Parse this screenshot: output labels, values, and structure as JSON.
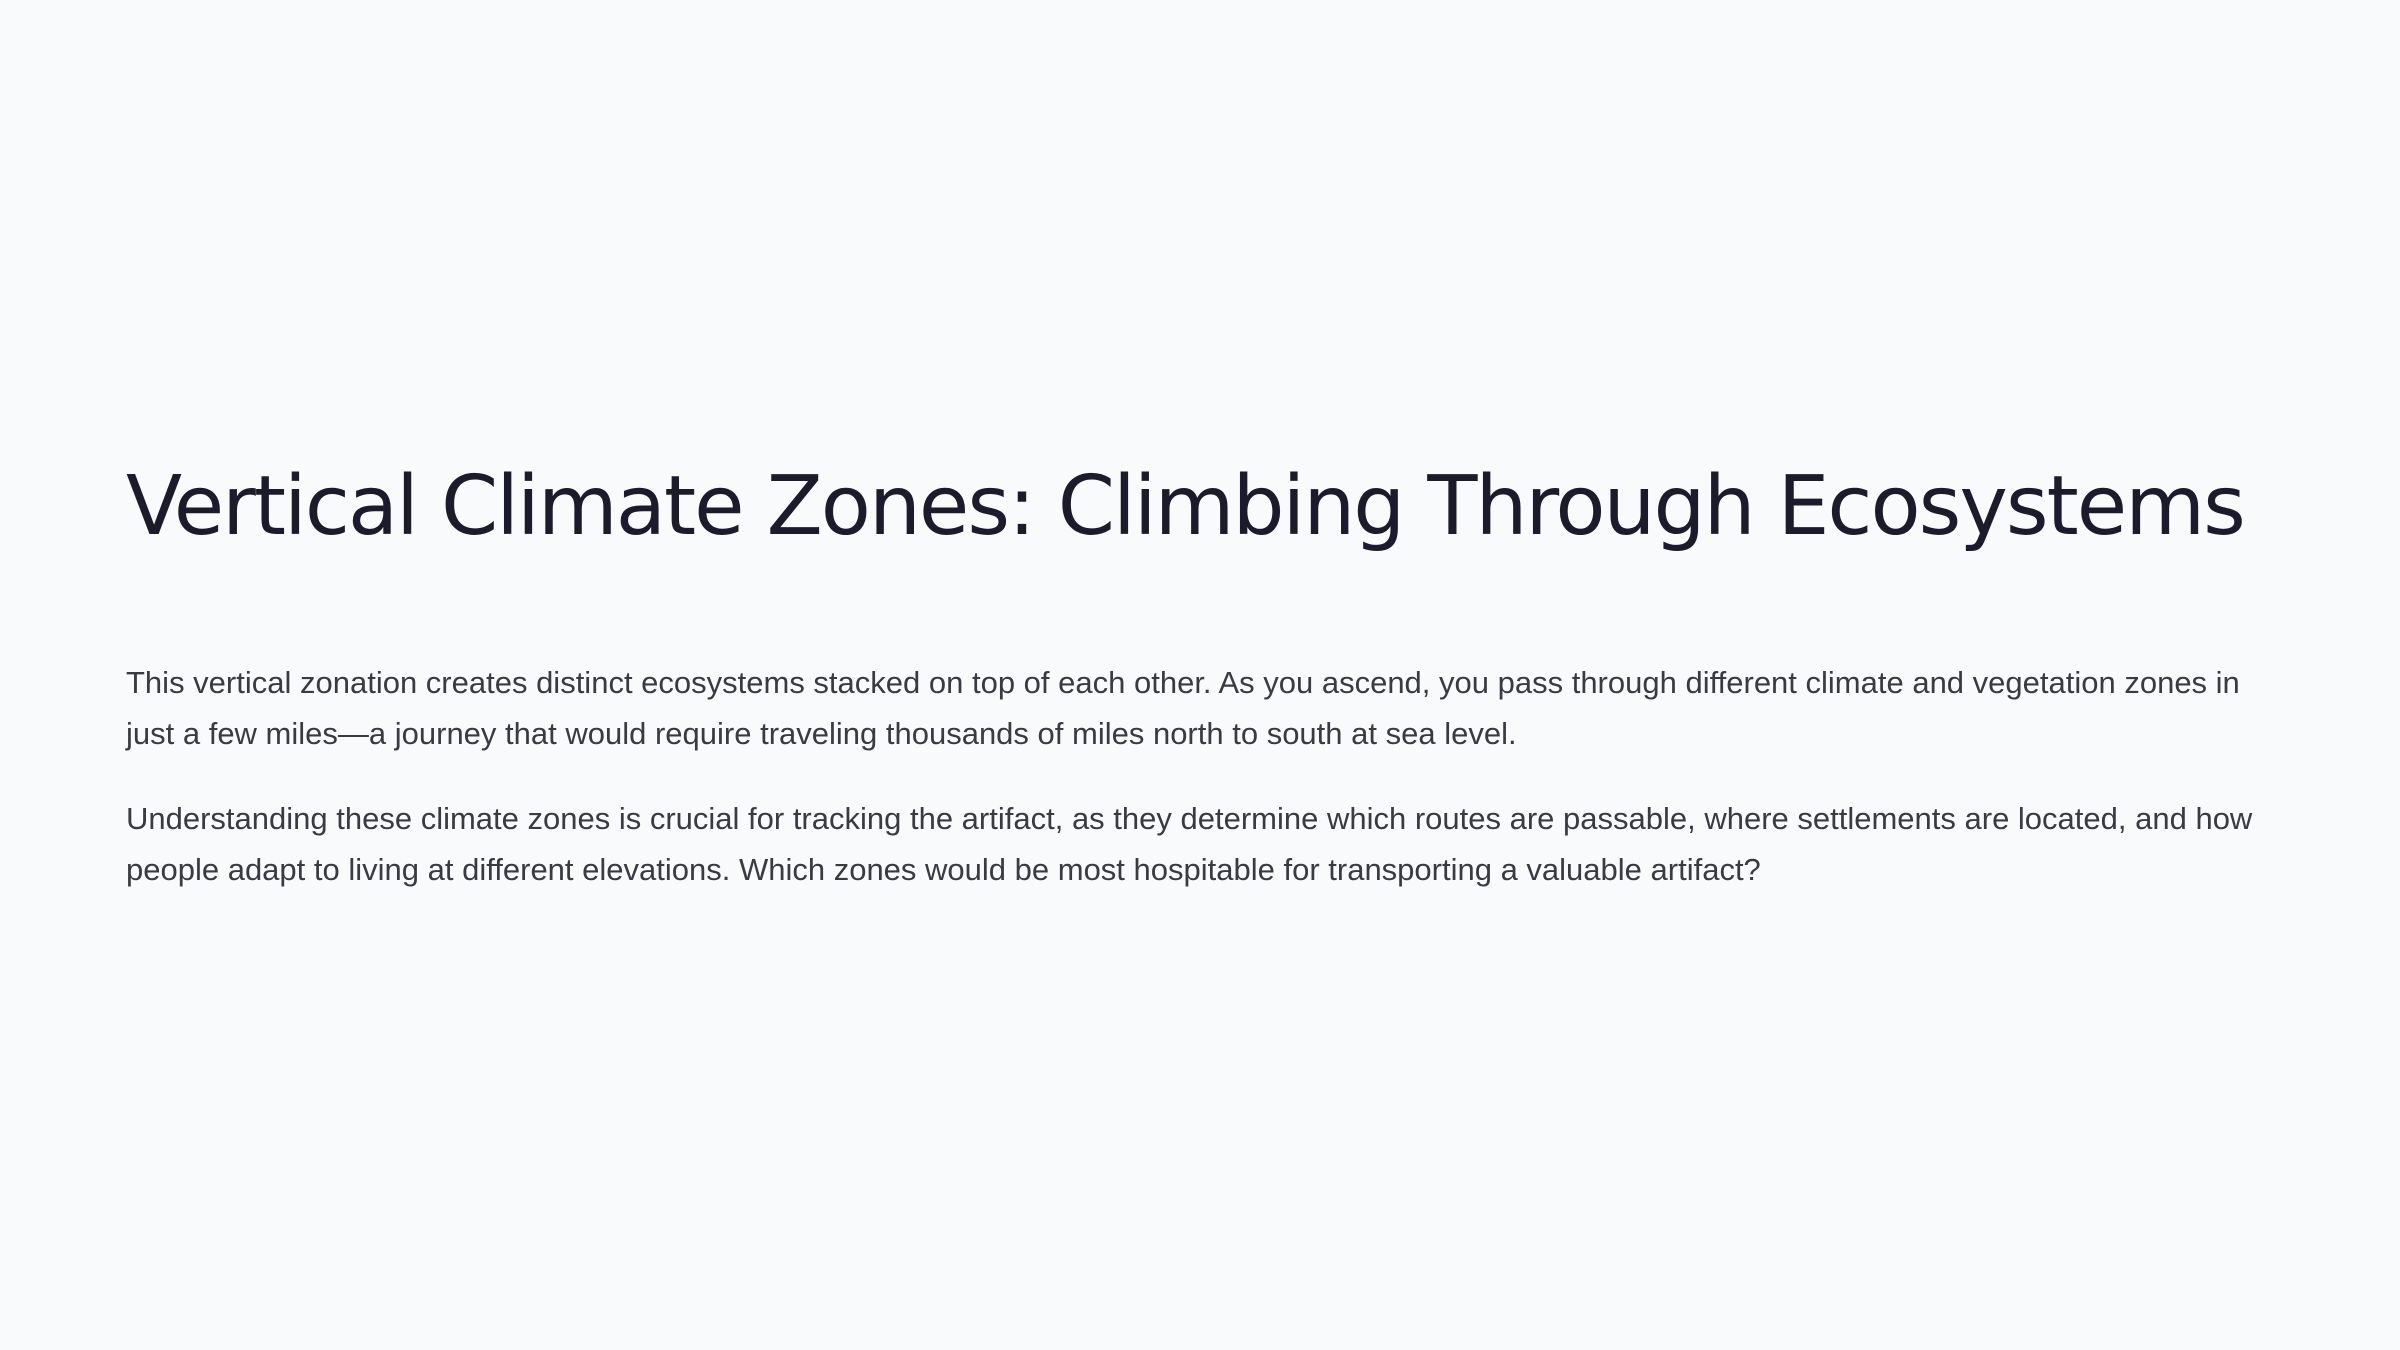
{
  "slide": {
    "title": "Vertical Climate Zones: Climbing Through Ecosystems",
    "paragraphs": [
      "This vertical zonation creates distinct ecosystems stacked on top of each other. As you ascend, you pass through different climate and vegetation zones in just a few miles—a journey that would require traveling thousands of miles north to south at sea level.",
      "Understanding these climate zones is crucial for tracking the artifact, as they determine which routes are passable, where settlements are located, and how people adapt to living at different elevations. Which zones would be most hospitable for transporting a valuable artifact?"
    ]
  },
  "colors": {
    "background": "#f9fafc",
    "title": "#1c1b2b",
    "body_text": "#3a3a42"
  }
}
